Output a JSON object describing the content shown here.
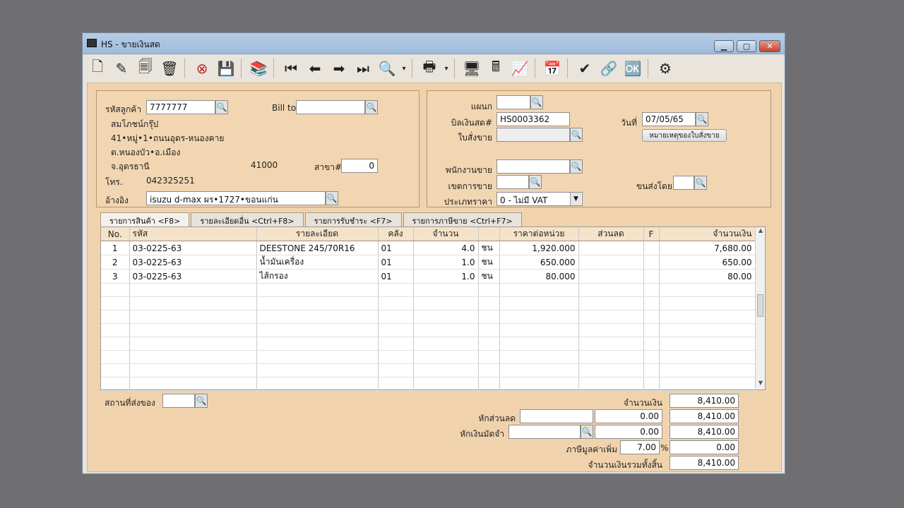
{
  "window": {
    "title": "HS - ขายเงินสด"
  },
  "customer": {
    "code_label": "รหัสลูกค้า",
    "code": "7777777",
    "name": "สมโภชน์กรุ๊ป",
    "address1": "41•หมู่•1•ถนนอุดร-หนองคาย",
    "address2": "ต.หนองบัว•อ.เมือง",
    "province": "จ.อุดรธานี",
    "zip": "41000",
    "branch_label": "สาขา#",
    "branch": "0",
    "phone_label": "โทร.",
    "phone": "042325251",
    "ref_label": "อ้างอิง",
    "ref": "isuzu d-max ผร•1727•ขอนแก่น",
    "bill_to_label": "Bill to",
    "bill_to": ""
  },
  "document": {
    "dept_label": "แผนก",
    "dept": "",
    "bill_label": "บิลเงินสด#",
    "bill_no": "HS0003362",
    "date_label": "วันที่",
    "date": "07/05/65",
    "order_label": "ใบสั่งขาย",
    "order": "",
    "order_note_button": "หมายเหตุของใบสั่งขาย",
    "salesman_label": "พนักงานขาย",
    "salesman": "",
    "area_label": "เขตการขาย",
    "area": "",
    "shipby_label": "ขนส่งโดย",
    "shipby": "",
    "pricetype_label": "ประเภทราคา",
    "pricetype": "0 - ไม่มี VAT"
  },
  "tabs": [
    "รายการสินค้า <F8>",
    "รายละเอียดอื่น <Ctrl+F8>",
    "รายการรับชำระ <F7>",
    "รายการภาษีขาย <Ctrl+F7>"
  ],
  "grid": {
    "headers": [
      "No.",
      "รหัส",
      "รายละเอียด",
      "คลัง",
      "จำนวน",
      "",
      "ราคาต่อหน่วย",
      "ส่วนลด",
      "F",
      "จำนวนเงิน"
    ],
    "rows": [
      [
        "1",
        "03-0225-63",
        "DEESTONE 245/70R16",
        "01",
        "4.0",
        "ชน",
        "1,920.000",
        "",
        "",
        "7,680.00"
      ],
      [
        "2",
        "03-0225-63",
        "น้ำมันเครื่อง",
        "01",
        "1.0",
        "ชน",
        "650.000",
        "",
        "",
        "650.00"
      ],
      [
        "3",
        "03-0225-63",
        "ไส้กรอง",
        "01",
        "1.0",
        "ชน",
        "80.000",
        "",
        "",
        "80.00"
      ]
    ]
  },
  "footer": {
    "ship_place_label": "สถานที่ส่งของ",
    "ship_place": "",
    "amount_label": "จำนวนเงิน",
    "amount": "8,410.00",
    "discount_label": "หักส่วนลด",
    "discount_text": "",
    "discount_value": "0.00",
    "after_discount": "8,410.00",
    "deposit_label": "หักเงินมัดจำ",
    "deposit_text": "",
    "deposit_value": "0.00",
    "after_deposit": "8,410.00",
    "vat_label": "ภาษีมูลค่าเพิ่ม",
    "vat_rate": "7.00",
    "vat_pct_sign": "%",
    "vat_amount": "0.00",
    "total_label": "จำนวนเงินรวมทั้งสิ้น",
    "total": "8,410.00"
  },
  "colors": {
    "panel_bg": "#f2d6b1",
    "title_bg": "#a9c3e2",
    "close_btn": "#c1432c"
  }
}
